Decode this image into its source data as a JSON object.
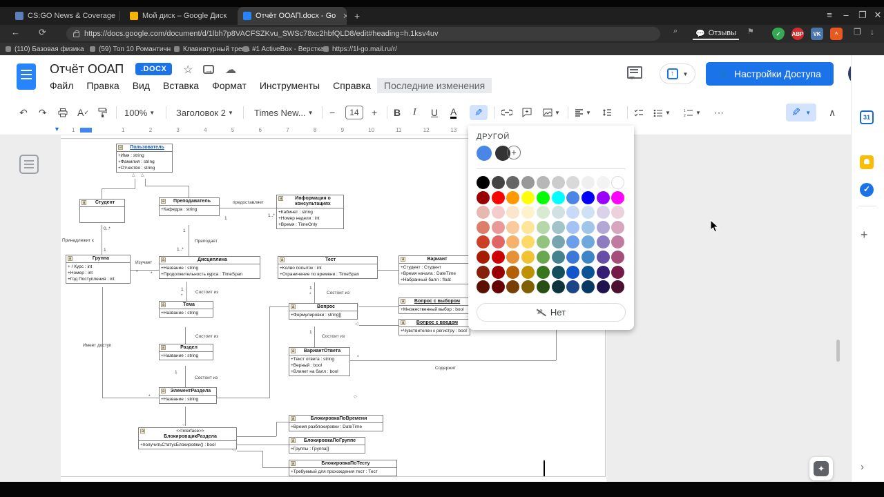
{
  "browser": {
    "tabs": [
      {
        "title": "CS:GO News & Coverage",
        "favicon": "#5b7fbb"
      },
      {
        "title": "Мой диск – Google Диск",
        "favicon": "#f4b400"
      },
      {
        "title": "Отчёт ООАП.docx - Go",
        "favicon": "#2684fc",
        "active": true,
        "close": "✕"
      }
    ],
    "new_tab_label": "+",
    "window_controls": {
      "menu": "≡",
      "minimize": "–",
      "restore": "❐",
      "close": "✕"
    },
    "back": "←",
    "reload": "⟳",
    "url": "https://docs.google.com/document/d/1lbh7p8VACFSZKvu_SWSc78xc2hbfQLD8/edit#heading=h.1ksv4uv",
    "feedback_label": "Отзывы",
    "extensions": [
      {
        "name": "adguard-shield",
        "bg": "#34a853",
        "glyph": "✓"
      },
      {
        "name": "adblock-plus",
        "bg": "#d22d2d",
        "glyph": "ABP"
      },
      {
        "name": "vk",
        "bg": "#4a76a8",
        "glyph": "VK"
      },
      {
        "name": "sovetnik",
        "bg": "#e8591f",
        "glyph": "^"
      }
    ],
    "bookmarks": [
      "(110) Базовая физика",
      "(59) Топ 10 Романтичн",
      "Клавиатурный трена",
      "#1 ActiveBox - Верстка",
      "https://1l-go.mail.ru/r/"
    ]
  },
  "header": {
    "title": "Отчёт ООАП",
    "badge": ".DOCX",
    "menus": [
      "Файл",
      "Правка",
      "Вид",
      "Вставка",
      "Формат",
      "Инструменты",
      "Справка"
    ],
    "status": "Последние изменения",
    "share_label": "Настройки Доступа"
  },
  "toolbar": {
    "zoom": "100%",
    "style": "Заголовок 2",
    "font": "Times New...",
    "size": "14",
    "bold": "B",
    "italic": "I",
    "underline": "U",
    "text_color": "A",
    "more": "⋯"
  },
  "ruler": {
    "margin_number": "1",
    "numbers": [
      "1",
      "2",
      "3",
      "4",
      "5",
      "6",
      "7",
      "8",
      "9",
      "10",
      "11",
      "12",
      "13"
    ]
  },
  "picker": {
    "title": "ДРУГОЙ",
    "custom": [
      "#4a86e8",
      "#333333"
    ],
    "add_label": "+",
    "rows": [
      [
        "#000000",
        "#434343",
        "#666666",
        "#999999",
        "#b7b7b7",
        "#cccccc",
        "#d9d9d9",
        "#efefef",
        "#f3f3f3",
        "#ffffff"
      ],
      [
        "#980000",
        "#ff0000",
        "#ff9900",
        "#ffff00",
        "#00ff00",
        "#00ffff",
        "#4a86e8",
        "#0000ff",
        "#9900ff",
        "#ff00ff"
      ],
      [
        "#e6b8af",
        "#f4cccc",
        "#fce5cd",
        "#fff2cc",
        "#d9ead3",
        "#d0e0e3",
        "#c9daf8",
        "#cfe2f3",
        "#d9d2e9",
        "#ead1dc"
      ],
      [
        "#dd7e6b",
        "#ea9999",
        "#f9cb9c",
        "#ffe599",
        "#b6d7a8",
        "#a2c4c9",
        "#a4c2f4",
        "#9fc5e8",
        "#b4a7d6",
        "#d5a6bd"
      ],
      [
        "#cc4125",
        "#e06666",
        "#f6b26b",
        "#ffd966",
        "#93c47d",
        "#76a5af",
        "#6d9eeb",
        "#6fa8dc",
        "#8e7cc3",
        "#c27ba0"
      ],
      [
        "#a61c00",
        "#cc0000",
        "#e69138",
        "#f1c232",
        "#6aa84f",
        "#45818e",
        "#3c78d8",
        "#3d85c6",
        "#674ea7",
        "#a64d79"
      ],
      [
        "#85200c",
        "#990000",
        "#b45f06",
        "#bf9000",
        "#38761d",
        "#134f5c",
        "#1155cc",
        "#0b5394",
        "#351c75",
        "#741b47"
      ],
      [
        "#5b0f00",
        "#660000",
        "#783f04",
        "#7f6000",
        "#274e13",
        "#0c343d",
        "#1c4587",
        "#073763",
        "#20124d",
        "#4c1130"
      ]
    ],
    "none_label": "Нет"
  },
  "diagram": {
    "classes": [
      {
        "name": "Пользователь",
        "attrs": [
          "+Имя : string",
          "+Фамилия : string",
          "+Отчество : string"
        ],
        "link": true
      },
      {
        "name": "Студент",
        "attrs": []
      },
      {
        "name": "Преподаватель",
        "attrs": [
          "+Кафедра : string"
        ]
      },
      {
        "name": "Информация о консультациях",
        "attrs": [
          "+Кабинет : string",
          "+Номер недели : int",
          "+Время : TimeOnly"
        ]
      },
      {
        "name": "Группа",
        "attrs": [
          "+ / Курс : int",
          "+Номер : int",
          "+Год Поступления : int"
        ]
      },
      {
        "name": "Дисциплина",
        "attrs": [
          "+Название : string",
          "+Продолжительность курса : TimeSpan"
        ]
      },
      {
        "name": "Тест",
        "attrs": [
          "+Колво попыток : int",
          "+Ограничение по времени : TimeSpan"
        ]
      },
      {
        "name": "Вариант",
        "attrs": [
          "+Студент : Студент",
          "+Время начала : DateTime",
          "+Набранный балл : float"
        ]
      },
      {
        "name": "Тема",
        "attrs": [
          "+Название : string"
        ]
      },
      {
        "name": "Вопрос",
        "attrs": [
          "+Формулировки : string[]"
        ]
      },
      {
        "name": "Вопрос с выбором",
        "attrs": [
          "+Множественный выбор : bool"
        ],
        "u": true
      },
      {
        "name": "Вопрос с вводом",
        "attrs": [
          "+Чувствителен к регистру : bool"
        ],
        "u": true
      },
      {
        "name": "Раздел",
        "attrs": [
          "+Название : string"
        ]
      },
      {
        "name": "ВариантОтвета",
        "attrs": [
          "+Текст ответа : string",
          "+Верный : bool",
          "+Влияет на балл : bool"
        ]
      },
      {
        "name": "ЭлементРаздела",
        "attrs": [
          "+Название : string"
        ]
      },
      {
        "name": "БлокировщикРаздела",
        "stereotype": "<<Interface>>",
        "attrs": [
          "+получитьСтатусБлокировки() : bool"
        ]
      },
      {
        "name": "БлокировкаПоВремени",
        "attrs": [
          "+Время разблокировки : DateTime"
        ]
      },
      {
        "name": "БлокировкаПоГруппе",
        "attrs": [
          "+Группы : Группа[]"
        ]
      },
      {
        "name": "БлокировкаПоТесту",
        "attrs": [
          "+Требуемый для прохождения тест : Тест"
        ]
      }
    ],
    "labels": [
      "предоставляет",
      "Принадлежит к",
      "Преподает",
      "Изучает",
      "Состоит из",
      "Состоит из",
      "Состоит из",
      "Состоит из",
      "Состоит из",
      "Имеет доступ",
      "Содержит"
    ],
    "mults": [
      "0..*",
      "1",
      "1",
      "1..*",
      "1",
      "1..*",
      "*",
      "*",
      "1",
      "*",
      "1",
      "*",
      "1",
      "1",
      "*",
      "*"
    ]
  },
  "side_panel": {
    "calendar_day": "31",
    "tasks_check": "✓",
    "add_label": "+",
    "collapse_label": "›"
  },
  "explore_glyph": "✦"
}
